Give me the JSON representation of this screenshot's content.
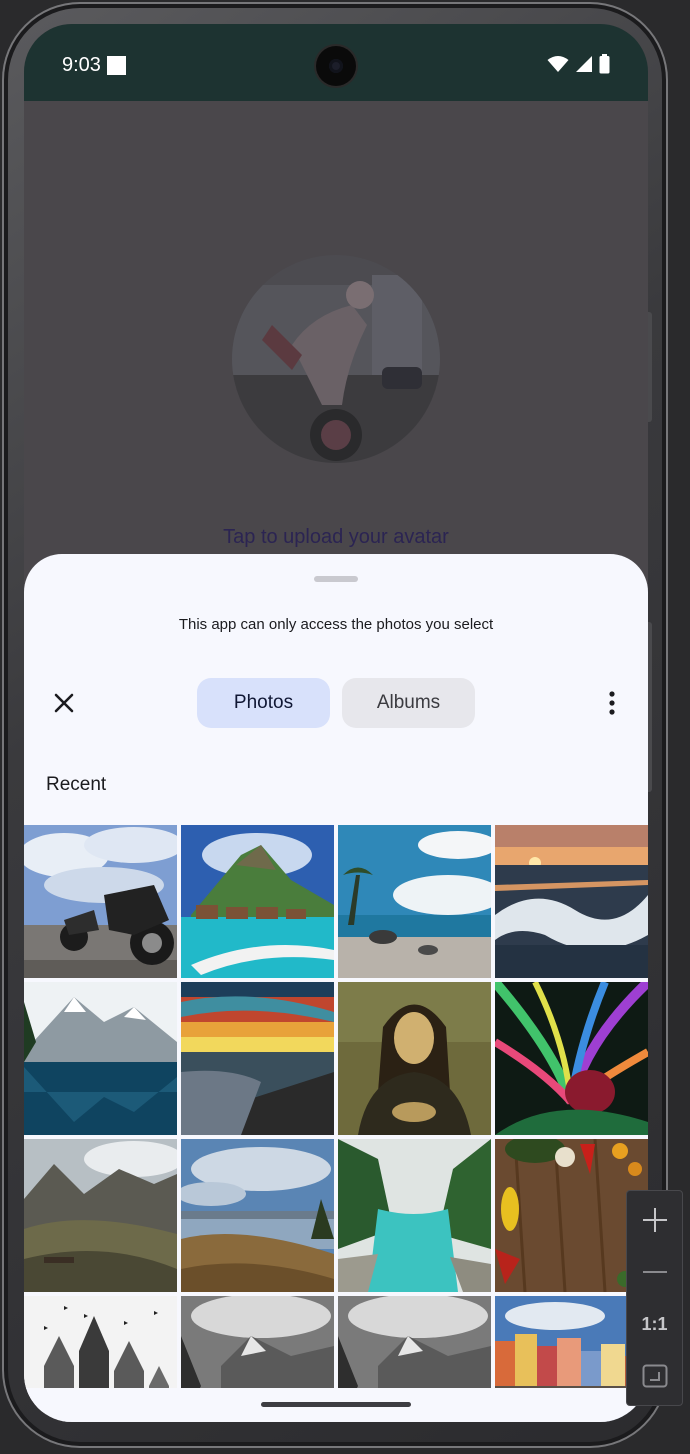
{
  "status_bar": {
    "time": "9:03"
  },
  "app": {
    "avatar_hint": "Tap to upload your avatar"
  },
  "sheet": {
    "notice": "This app can only access the photos you select",
    "tabs": [
      {
        "label": "Photos",
        "selected": true
      },
      {
        "label": "Albums",
        "selected": false
      }
    ],
    "section_label": "Recent",
    "photos": [
      {
        "icon": "motorcycles-photo"
      },
      {
        "icon": "tropical-island-photo"
      },
      {
        "icon": "beach-photo"
      },
      {
        "icon": "ocean-sunset-photo"
      },
      {
        "icon": "mountain-lake-photo"
      },
      {
        "icon": "sunset-sky-photo"
      },
      {
        "icon": "mona-lisa-photo"
      },
      {
        "icon": "abstract-art-photo"
      },
      {
        "icon": "mountain-valley-photo"
      },
      {
        "icon": "lake-landscape-photo"
      },
      {
        "icon": "river-forest-photo"
      },
      {
        "icon": "vegetables-photo"
      },
      {
        "icon": "cathedral-photo"
      },
      {
        "icon": "mountain-bw-photo"
      },
      {
        "icon": "mountain-bw-photo"
      },
      {
        "icon": "colorful-village-photo"
      }
    ]
  },
  "zoom_controls": {
    "actual_size_label": "1:1"
  },
  "colors": {
    "status_bar_bg": "#1d3331",
    "sheet_bg": "#f7f8fe",
    "tab_selected_bg": "#d8e1fb",
    "tab_unselected_bg": "#e7e7ec",
    "scrim": "#4a474b"
  }
}
